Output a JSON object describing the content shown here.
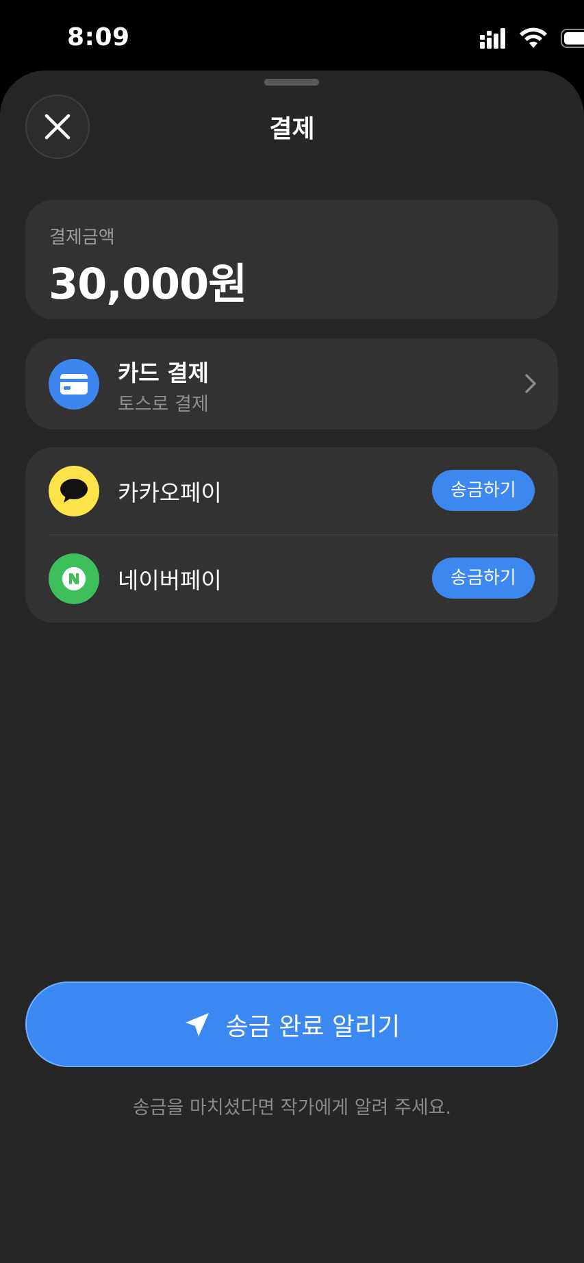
{
  "status_bar": {
    "time": "8:09",
    "icons": [
      "signal-icon",
      "wifi-icon",
      "battery-icon"
    ]
  },
  "sheet": {
    "title": "결제",
    "close_icon": "close-icon"
  },
  "amount": {
    "label": "결제금액",
    "value": "30,000원"
  },
  "card_payment": {
    "title": "카드 결제",
    "subtitle": "토스로 결제",
    "icon": "credit-card-icon",
    "accent": "#3d86f0"
  },
  "payments": [
    {
      "name": "카카오페이",
      "button": "송금하기",
      "icon": "kakao-icon",
      "color": "#fee34b"
    },
    {
      "name": "네이버페이",
      "button": "송금하기",
      "icon": "naver-icon",
      "color": "#3ebf5c"
    }
  ],
  "notify": {
    "label": "송금 완료 알리기",
    "icon": "paper-plane-icon",
    "color": "#3c88f2"
  },
  "footer_note": "송금을 마치셨다면 작가에게 알려 주세요."
}
